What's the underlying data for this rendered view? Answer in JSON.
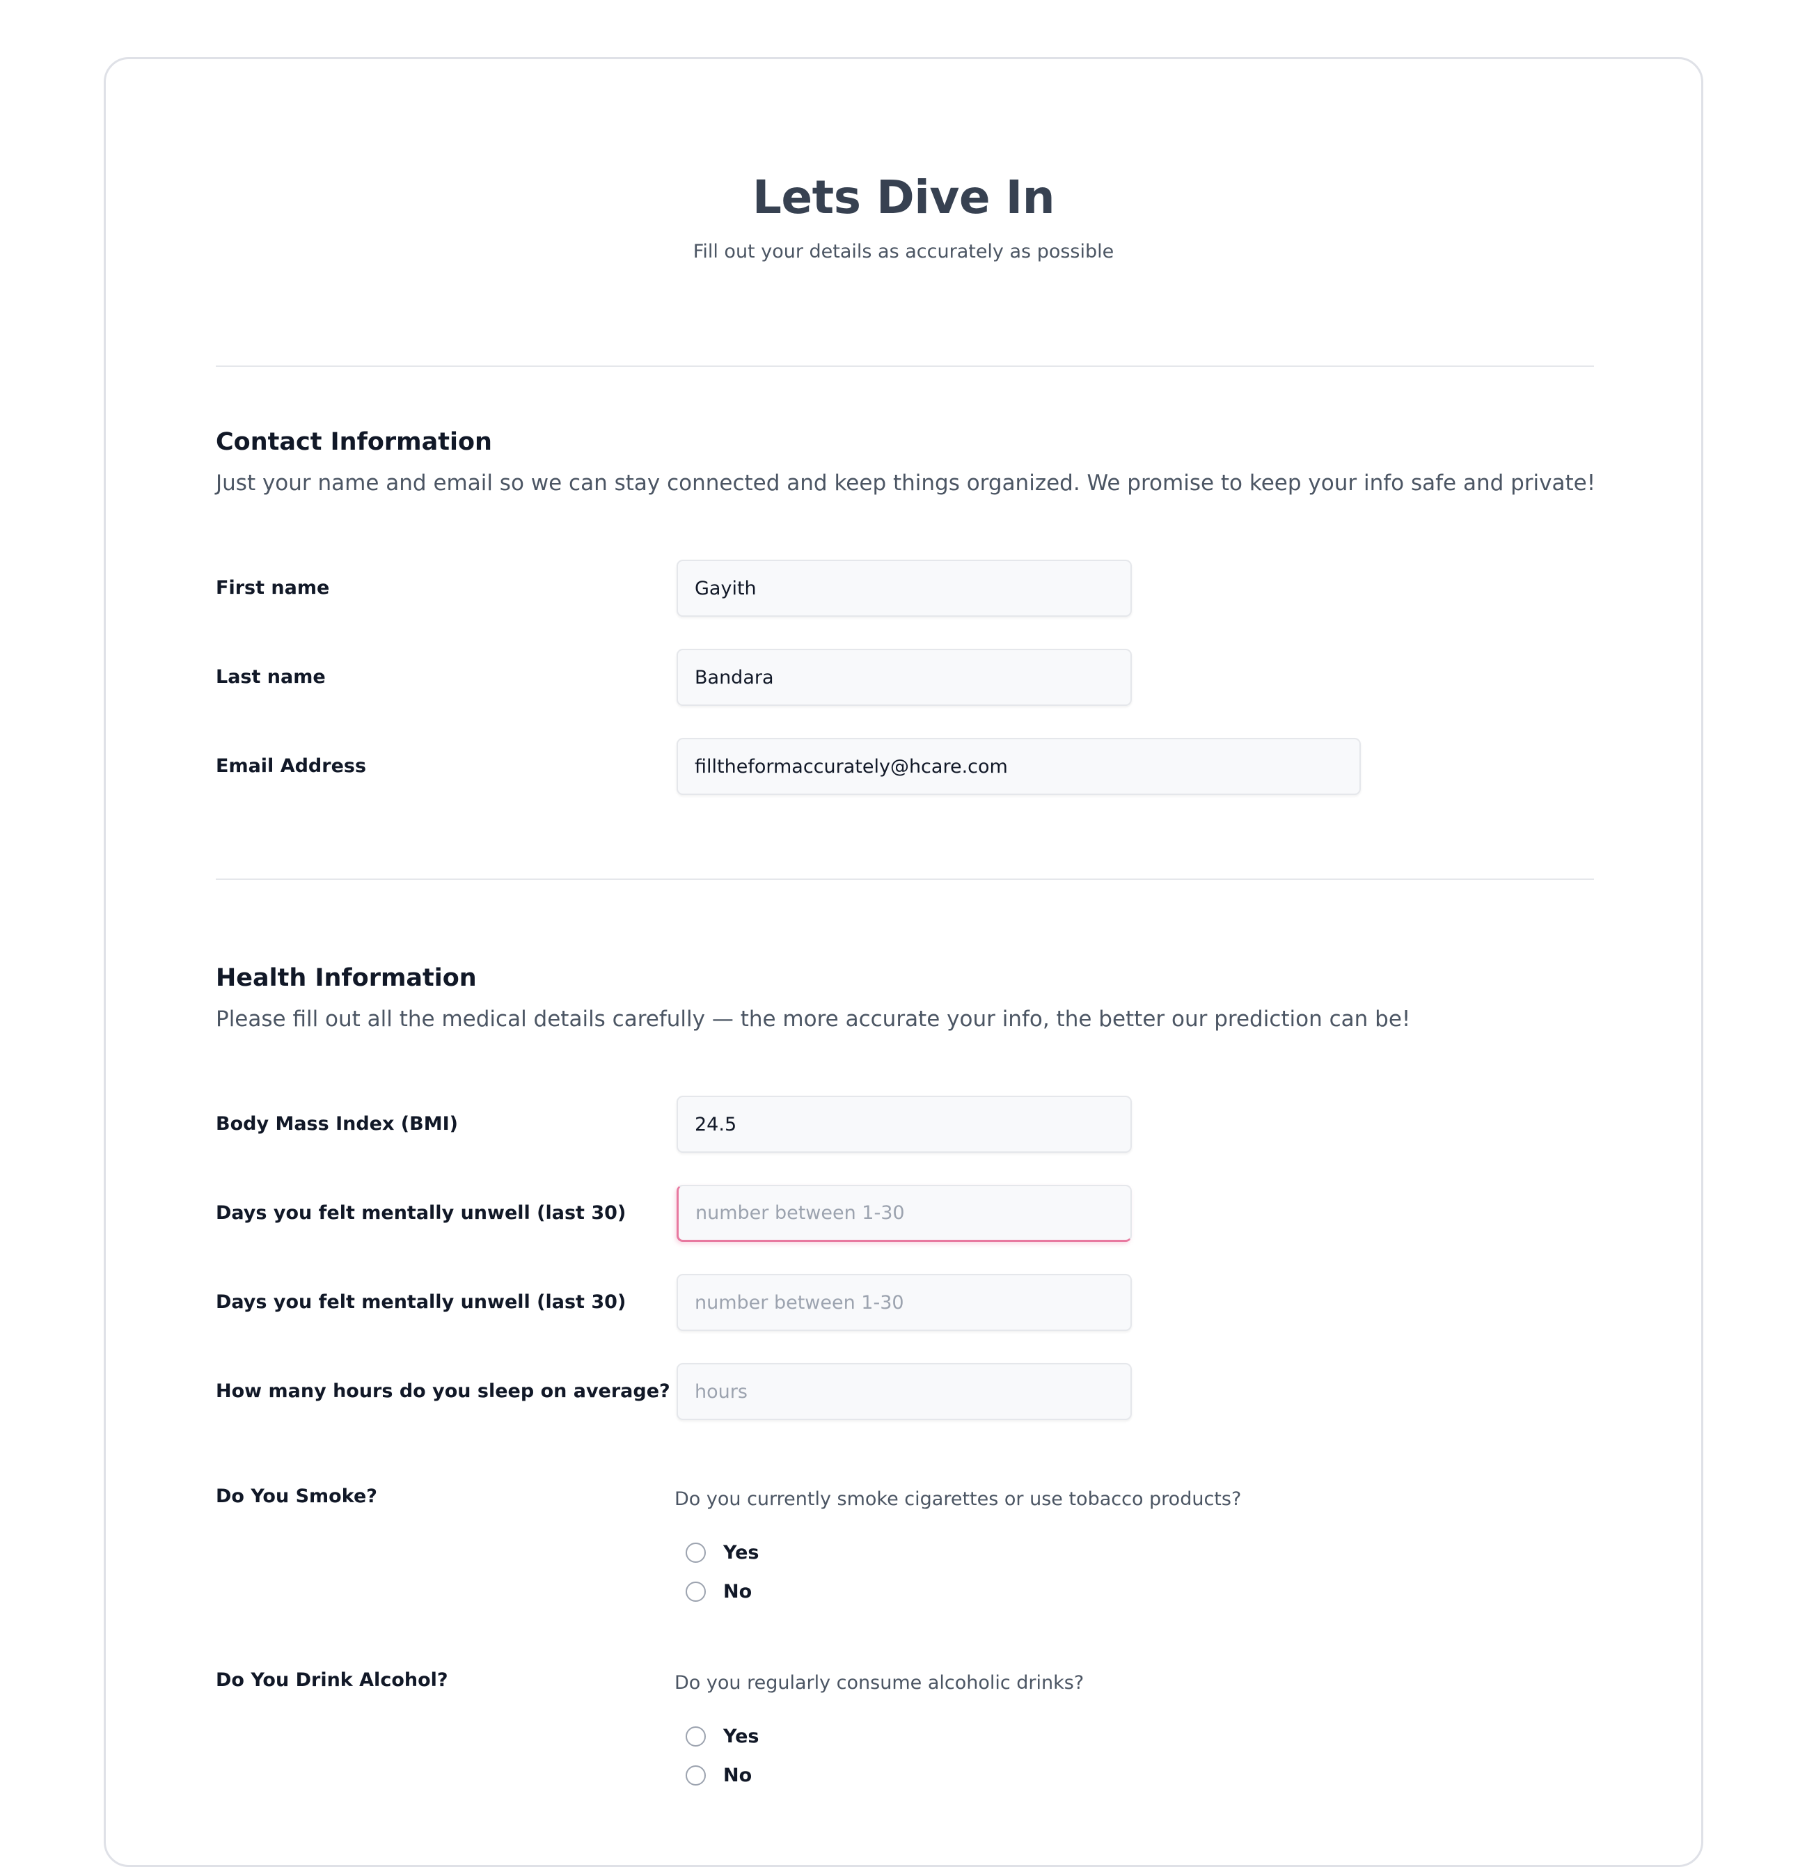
{
  "header": {
    "title": "Lets Dive In",
    "subtitle": "Fill out your details as accurately as possible"
  },
  "contact": {
    "title": "Contact Information",
    "description": "Just your name and email so we can stay connected and keep things organized. We promise to keep your info safe and private!",
    "first_name": {
      "label": "First name",
      "value": "Gayith"
    },
    "last_name": {
      "label": "Last name",
      "value": "Bandara"
    },
    "email": {
      "label": "Email Address",
      "value": "filltheformaccurately@hcare.com"
    }
  },
  "health": {
    "title": "Health Information",
    "description": "Please fill out all the medical details carefully — the more accurate your info, the better our prediction can be!",
    "bmi": {
      "label": "Body Mass Index (BMI)",
      "value": "24.5"
    },
    "mental_days": {
      "label": "Days you felt mentally unwell (last 30)",
      "value": "",
      "placeholder": "number between 1-30"
    },
    "mental_days_2": {
      "label": "Days you felt mentally unwell (last 30)",
      "value": "",
      "placeholder": "number between 1-30"
    },
    "sleep": {
      "label": "How many hours do you sleep on average?",
      "value": "",
      "placeholder": "hours"
    },
    "smoke": {
      "label": "Do You Smoke?",
      "question": "Do you currently smoke cigarettes or use tobacco products?",
      "options": [
        "Yes",
        "No"
      ]
    },
    "alcohol": {
      "label": "Do You Drink Alcohol?",
      "question": "Do you regularly consume alcoholic drinks?",
      "options": [
        "Yes",
        "No"
      ]
    }
  },
  "colors": {
    "title": "#374151",
    "focus_accent": "#e879a0",
    "input_bg": "#f8f9fb",
    "border": "#e5e7eb"
  }
}
